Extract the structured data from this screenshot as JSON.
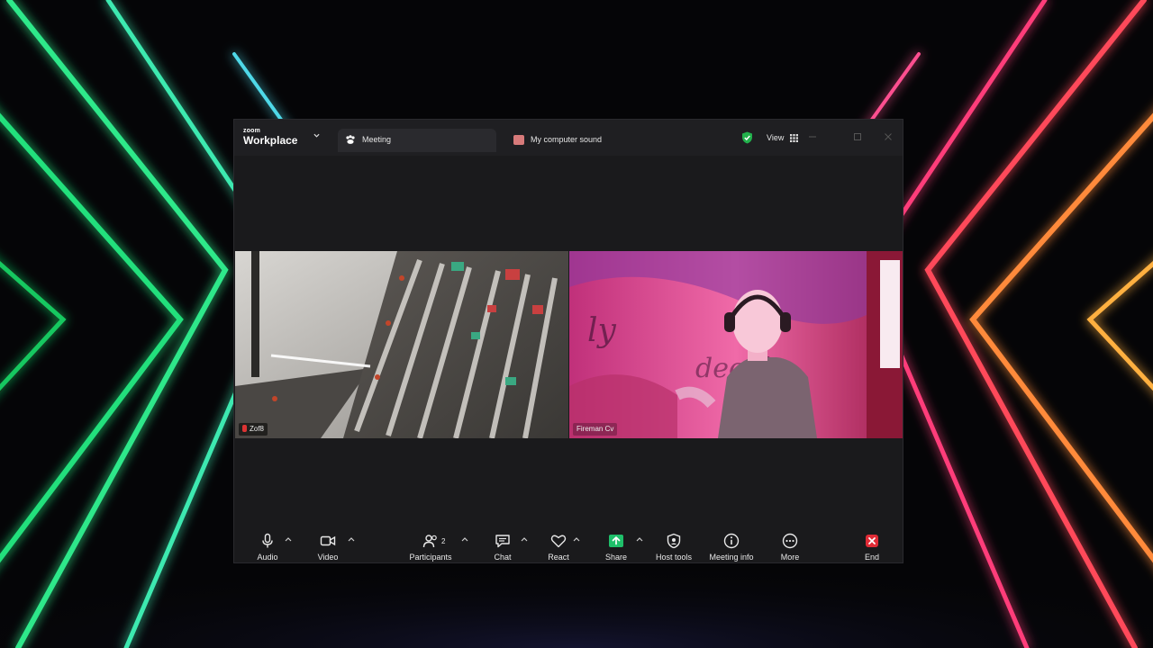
{
  "app": {
    "brand_small": "zoom",
    "brand_big": "Workplace"
  },
  "tabs": [
    {
      "label": "Meeting",
      "icon": "meeting-icon"
    },
    {
      "label": "My computer sound",
      "icon": "computer-sound-icon"
    }
  ],
  "header": {
    "view_label": "View",
    "security_icon": "shield-check-icon"
  },
  "participants": [
    {
      "name": "Zof8",
      "muted": true
    },
    {
      "name": "Fireman Cv",
      "muted": false
    }
  ],
  "toolbar": {
    "audio": "Audio",
    "video": "Video",
    "participants": "Participants",
    "participants_count": "2",
    "chat": "Chat",
    "react": "React",
    "share": "Share",
    "host_tools": "Host tools",
    "meeting_info": "Meeting info",
    "more": "More",
    "end": "End"
  },
  "colors": {
    "share_green": "#1fbf6a",
    "end_red": "#e02b36",
    "shield_green": "#22b14c",
    "window_bg": "#1a1a1c"
  }
}
